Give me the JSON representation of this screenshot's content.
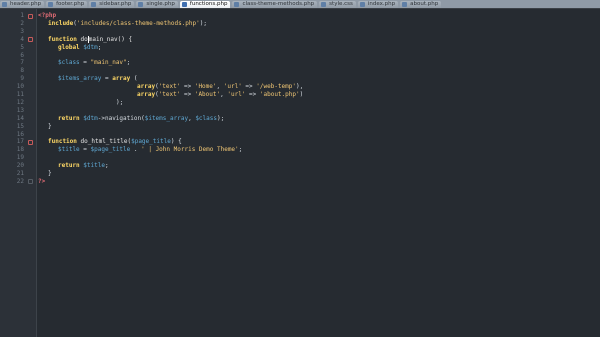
{
  "tabs": [
    {
      "label": "header.php",
      "active": false
    },
    {
      "label": "footer.php",
      "active": false
    },
    {
      "label": "sidebar.php",
      "active": false
    },
    {
      "label": "single.php",
      "active": false
    },
    {
      "label": "functions.php",
      "active": true
    },
    {
      "label": "class-theme-methods.php",
      "active": false
    },
    {
      "label": "style.css",
      "active": false
    },
    {
      "label": "index.php",
      "active": false
    },
    {
      "label": "about.php",
      "active": false
    }
  ],
  "line_numbers": [
    "1",
    "2",
    "3",
    "4",
    "5",
    "6",
    "7",
    "8",
    "9",
    "10",
    "11",
    "12",
    "13",
    "14",
    "15",
    "16",
    "17",
    "18",
    "19",
    "20",
    "21",
    "22"
  ],
  "code": {
    "l1": {
      "php_open": "<?php"
    },
    "l2": {
      "kw": "include",
      "rest": "(",
      "str": "'includes/class-theme-methods.php'",
      "end": ");"
    },
    "l4": {
      "kw": "function",
      "name": " do",
      "name2": "main_nav() {"
    },
    "l5": {
      "kw": "global",
      "var": " $dtm",
      "end": ";"
    },
    "l7": {
      "var": "$class",
      "mid": " = ",
      "str": "\"main_nav\"",
      "end": ";"
    },
    "l9": {
      "var": "$items_array",
      "mid": " = ",
      "kw": "array",
      "end": " ("
    },
    "l10": {
      "kw": "array",
      "p1": "(",
      "s1": "'text'",
      "p2": " => ",
      "s2": "'Home'",
      "p3": ", ",
      "s3": "'url'",
      "p4": " => ",
      "s4": "'/web-temp'",
      "end": "),"
    },
    "l11": {
      "kw": "array",
      "p1": "(",
      "s1": "'text'",
      "p2": " => ",
      "s2": "'About'",
      "p3": ", ",
      "s3": "'url'",
      "p4": " => ",
      "s4": "'about.php'",
      "end": ")"
    },
    "l12": {
      "text": ");"
    },
    "l14": {
      "kw": "return",
      "var": " $dtm",
      "mid": "->navigation(",
      "var2": "$items_array",
      "p": ", ",
      "var3": "$class",
      "end": ");"
    },
    "l15": {
      "text": "}"
    },
    "l17": {
      "kw": "function",
      "name": " do_html_title(",
      "var": "$page_title",
      "end": ") {"
    },
    "l18": {
      "var": "$title",
      "mid": " = ",
      "var2": "$page_title",
      "p": " . ",
      "str": "' | John Morris Demo Theme'",
      "end": ";"
    },
    "l20": {
      "kw": "return",
      "var": " $title",
      "end": ";"
    },
    "l21": {
      "text": "}"
    },
    "l22": {
      "php_close": "?>"
    }
  }
}
